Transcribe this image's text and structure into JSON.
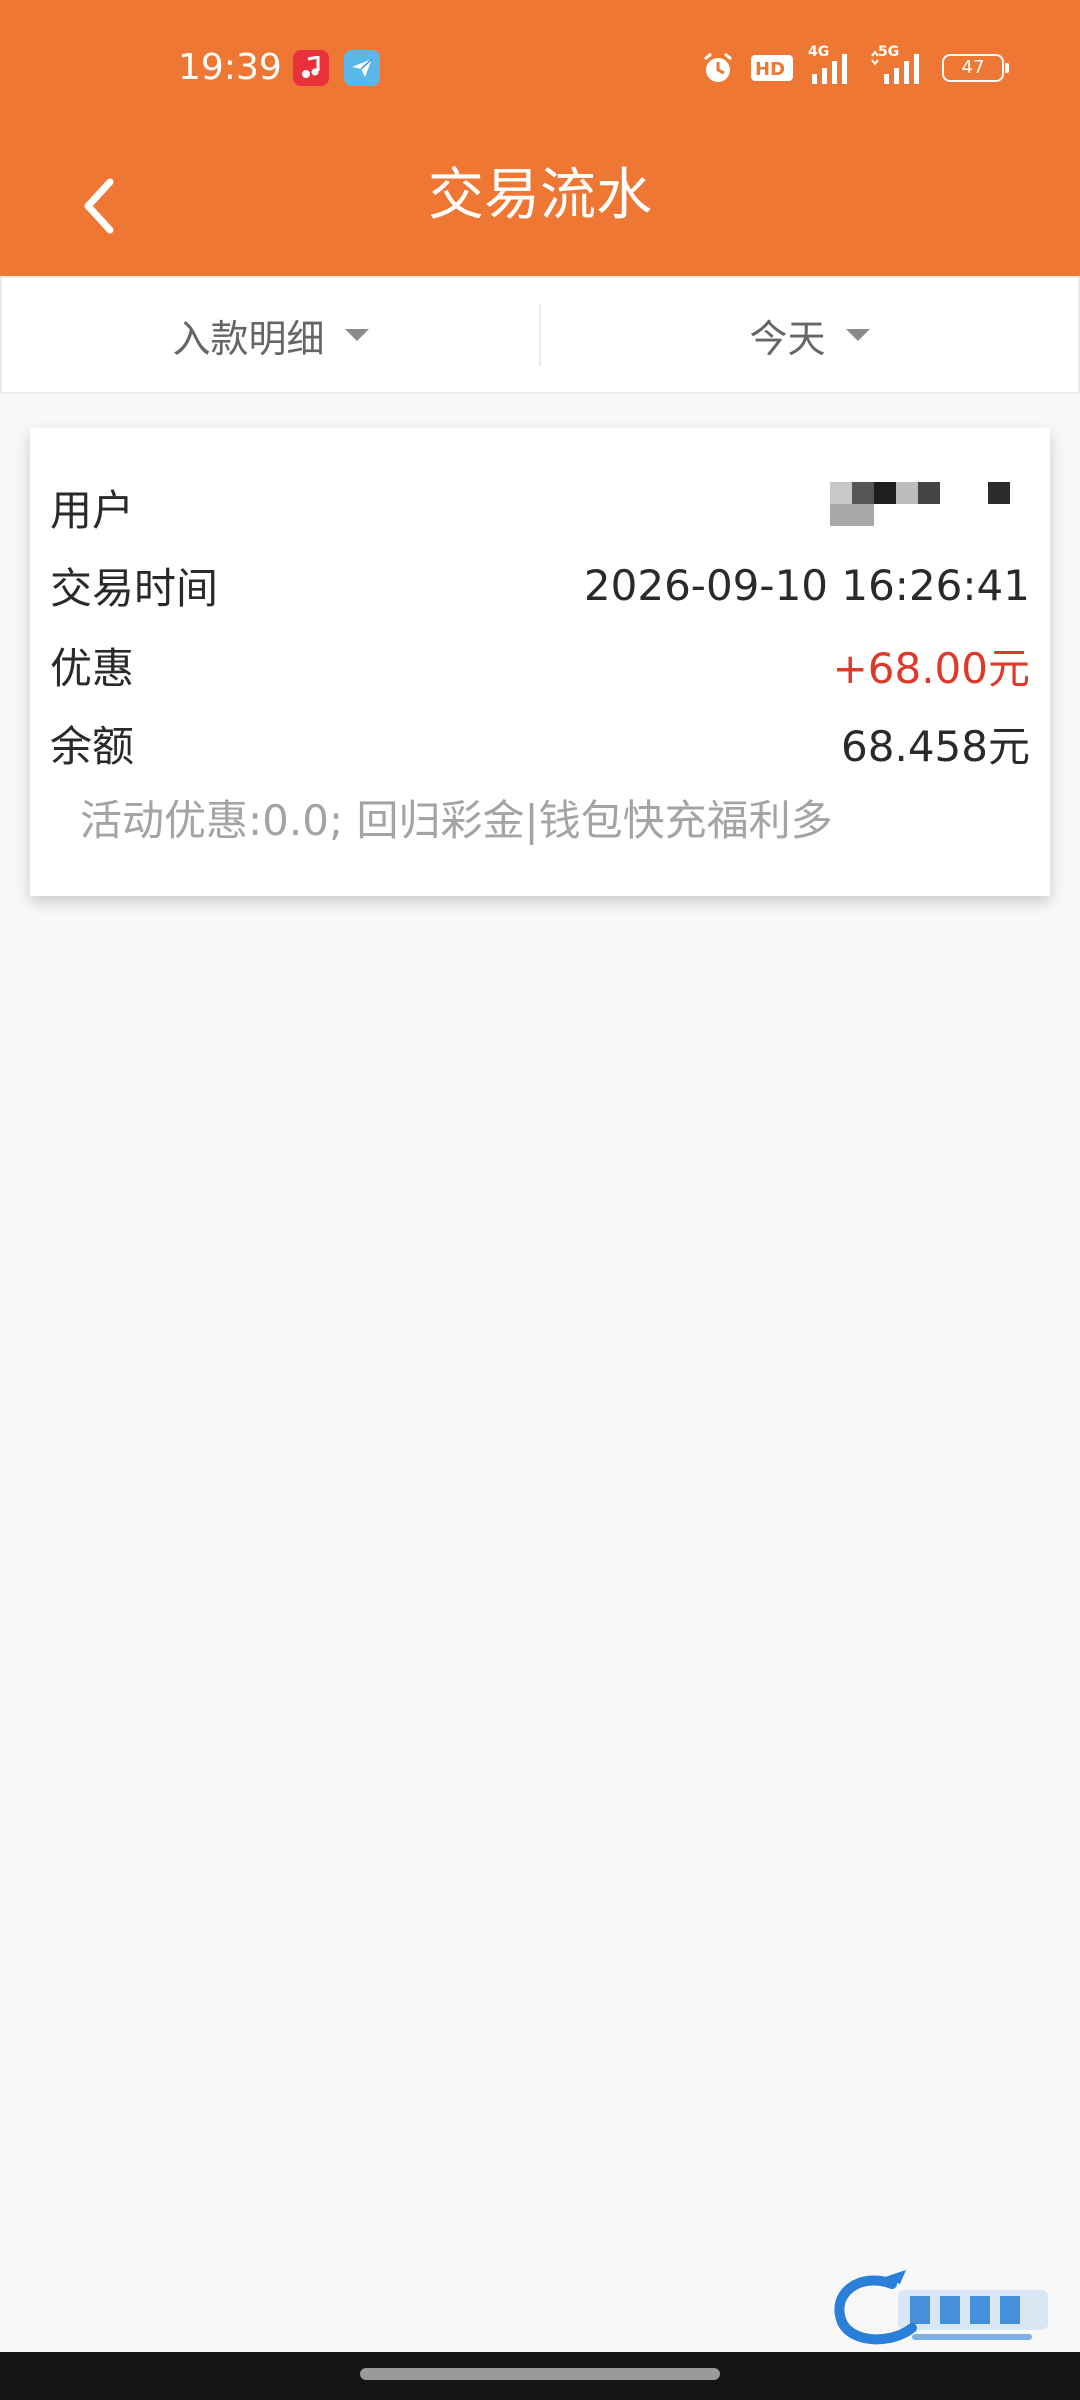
{
  "status_bar": {
    "time": "19:39",
    "network_4g": "4G",
    "network_5g": "5G",
    "battery": "47"
  },
  "app_bar": {
    "title": "交易流水"
  },
  "filters": {
    "type_label": "入款明细",
    "date_label": "今天"
  },
  "transaction": {
    "user_label": "用户",
    "time_label": "交易时间",
    "time_value": "2026-09-10 16:26:41",
    "discount_label": "优惠",
    "discount_value": "+68.00元",
    "balance_label": "余额",
    "balance_value": "68.458元",
    "note": "活动优惠:0.0;   回归彩金|钱包快充福利多"
  },
  "colors": {
    "header": "#ee7833",
    "positive_amount": "#dd3a2c",
    "note_text": "#a4a4a4"
  }
}
